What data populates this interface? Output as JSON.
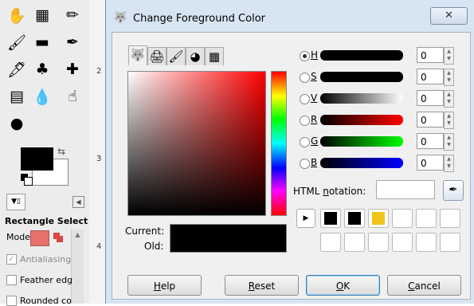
{
  "toolbox": {
    "tools": [
      {
        "name": "fuzzy-select-icon",
        "glyph": "✋"
      },
      {
        "name": "gradient-icon",
        "glyph": "▦"
      },
      {
        "name": "pencil-icon",
        "glyph": "✏"
      },
      {
        "name": "paintbrush-icon",
        "glyph": "🖌"
      },
      {
        "name": "eraser-icon",
        "glyph": "▬"
      },
      {
        "name": "airbrush-icon",
        "glyph": "✒"
      },
      {
        "name": "ink-icon",
        "glyph": "🖋"
      },
      {
        "name": "clone-icon",
        "glyph": "♣"
      },
      {
        "name": "heal-icon",
        "glyph": "✚"
      },
      {
        "name": "perspective-clone-icon",
        "glyph": "▤"
      },
      {
        "name": "blur-icon",
        "glyph": "💧"
      },
      {
        "name": "smudge-icon",
        "glyph": "☝"
      },
      {
        "name": "dodge-burn-icon",
        "glyph": "●"
      }
    ],
    "fg_color": "#000000",
    "bg_color": "#ffffff",
    "options_title": "Rectangle Select",
    "mode_label": "Mode:",
    "antialiasing_label": "Antialiasing",
    "feather_label": "Feather edg",
    "rounded_label": "Rounded co",
    "ruler_marks": [
      "2",
      "3",
      "4"
    ]
  },
  "dialog": {
    "title": "Change Foreground Color",
    "close_glyph": "✕",
    "tabs": [
      {
        "name": "gimp-selector-icon",
        "glyph": "🐺"
      },
      {
        "name": "cmyk-icon",
        "glyph": "🖨"
      },
      {
        "name": "watercolor-icon",
        "glyph": "🖌"
      },
      {
        "name": "wheel-icon",
        "glyph": "◕"
      },
      {
        "name": "palette-icon",
        "glyph": "▦"
      }
    ],
    "sliders": [
      {
        "key": "H",
        "value": "0",
        "gradient": "linear-gradient(to right,#000,#000)",
        "selected": true
      },
      {
        "key": "S",
        "value": "0",
        "gradient": "linear-gradient(to right,#000,#000)",
        "selected": false
      },
      {
        "key": "V",
        "value": "0",
        "gradient": "linear-gradient(to right,#000,#fff)",
        "selected": false
      },
      {
        "key": "R",
        "value": "0",
        "gradient": "linear-gradient(to right,#000,#ff0000)",
        "selected": false
      },
      {
        "key": "G",
        "value": "0",
        "gradient": "linear-gradient(to right,#000,#00ff00)",
        "selected": false
      },
      {
        "key": "B",
        "value": "0",
        "gradient": "linear-gradient(to right,#000,#0000ff)",
        "selected": false
      }
    ],
    "html_notation": {
      "label_pre": "HTML ",
      "label_key": "n",
      "label_post": "otation:",
      "value": ""
    },
    "current_label": "Current:",
    "old_label": "Old:",
    "current_color": "#000000",
    "history": [
      "#000000",
      "#000000",
      "#f0c419",
      "#ffffff",
      "#ffffff",
      "#ffffff",
      "#ffffff",
      "#ffffff",
      "#ffffff",
      "#ffffff",
      "#ffffff",
      "#ffffff"
    ],
    "buttons": {
      "help": {
        "key": "H",
        "rest": "elp"
      },
      "reset": {
        "key": "R",
        "rest": "eset"
      },
      "ok": {
        "key": "O",
        "rest": "K"
      },
      "cancel": {
        "key": "C",
        "rest": "ancel"
      }
    }
  }
}
